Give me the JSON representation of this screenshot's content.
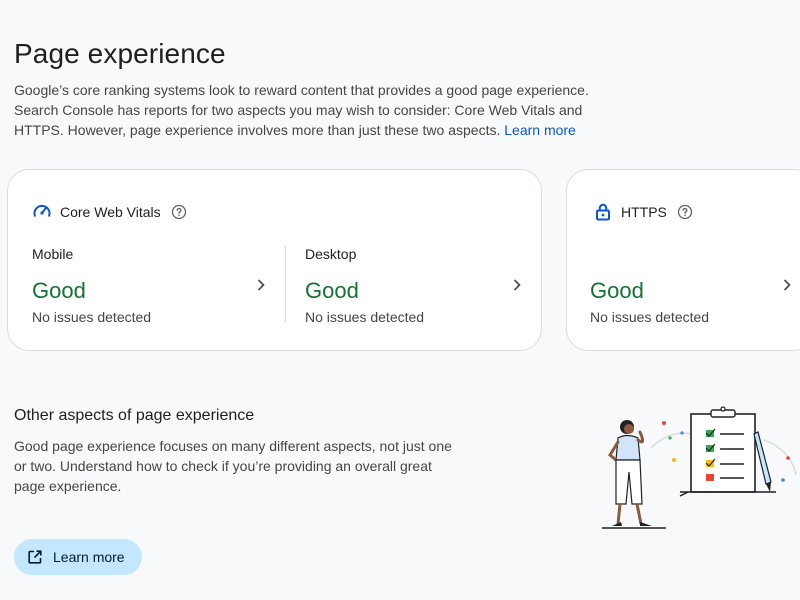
{
  "page": {
    "title": "Page experience",
    "intro": "Google’s core ranking systems look to reward content that provides a good page experience. Search Console has reports for two aspects you may wish to consider: Core Web Vitals and HTTPS. However, page experience involves more than just these two aspects.",
    "intro_link": "Learn more"
  },
  "core_web_vitals": {
    "title": "Core Web Vitals",
    "mobile": {
      "label": "Mobile",
      "status": "Good",
      "detail": "No issues detected"
    },
    "desktop": {
      "label": "Desktop",
      "status": "Good",
      "detail": "No issues detected"
    }
  },
  "https": {
    "title": "HTTPS",
    "status": "Good",
    "detail": "No issues detected"
  },
  "other": {
    "title": "Other aspects of page experience",
    "body": "Good page experience focuses on many different aspects, not just one or two. Understand how to check if you’re providing an overall great page experience.",
    "button": "Learn more"
  },
  "icons": {
    "gauge": "gauge-icon",
    "help": "help-icon",
    "lock": "lock-icon",
    "chevron": "chevron-right-icon",
    "open": "open-in-new-icon"
  },
  "colors": {
    "good": "#137333",
    "link": "#0b57d0",
    "button_bg": "#c2e7ff",
    "icon_blue": "#0b57d0"
  }
}
